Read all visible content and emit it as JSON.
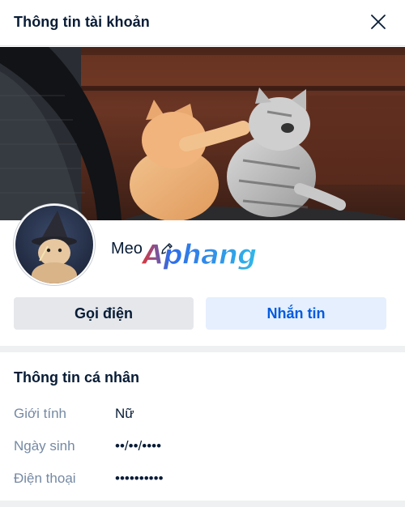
{
  "header": {
    "title": "Thông tin tài khoản",
    "close_icon": "close-icon"
  },
  "cover": {
    "description_icon": "cover-photo"
  },
  "profile": {
    "name": "Meo",
    "edit_icon": "pencil-icon",
    "watermark": "Aphang"
  },
  "actions": {
    "call_label": "Gọi điện",
    "message_label": "Nhắn tin"
  },
  "personal_info": {
    "title": "Thông tin cá nhân",
    "gender_label": "Giới tính",
    "gender_value": "Nữ",
    "dob_label": "Ngày sinh",
    "dob_value": "••/••/••••",
    "phone_label": "Điện thoại",
    "phone_value": "••••••••••"
  },
  "colors": {
    "primary_text": "#081c36",
    "secondary_text": "#7589a3",
    "accent_blue": "#005ae0",
    "message_bg": "#e5effe",
    "call_bg": "#e5e7eb"
  }
}
